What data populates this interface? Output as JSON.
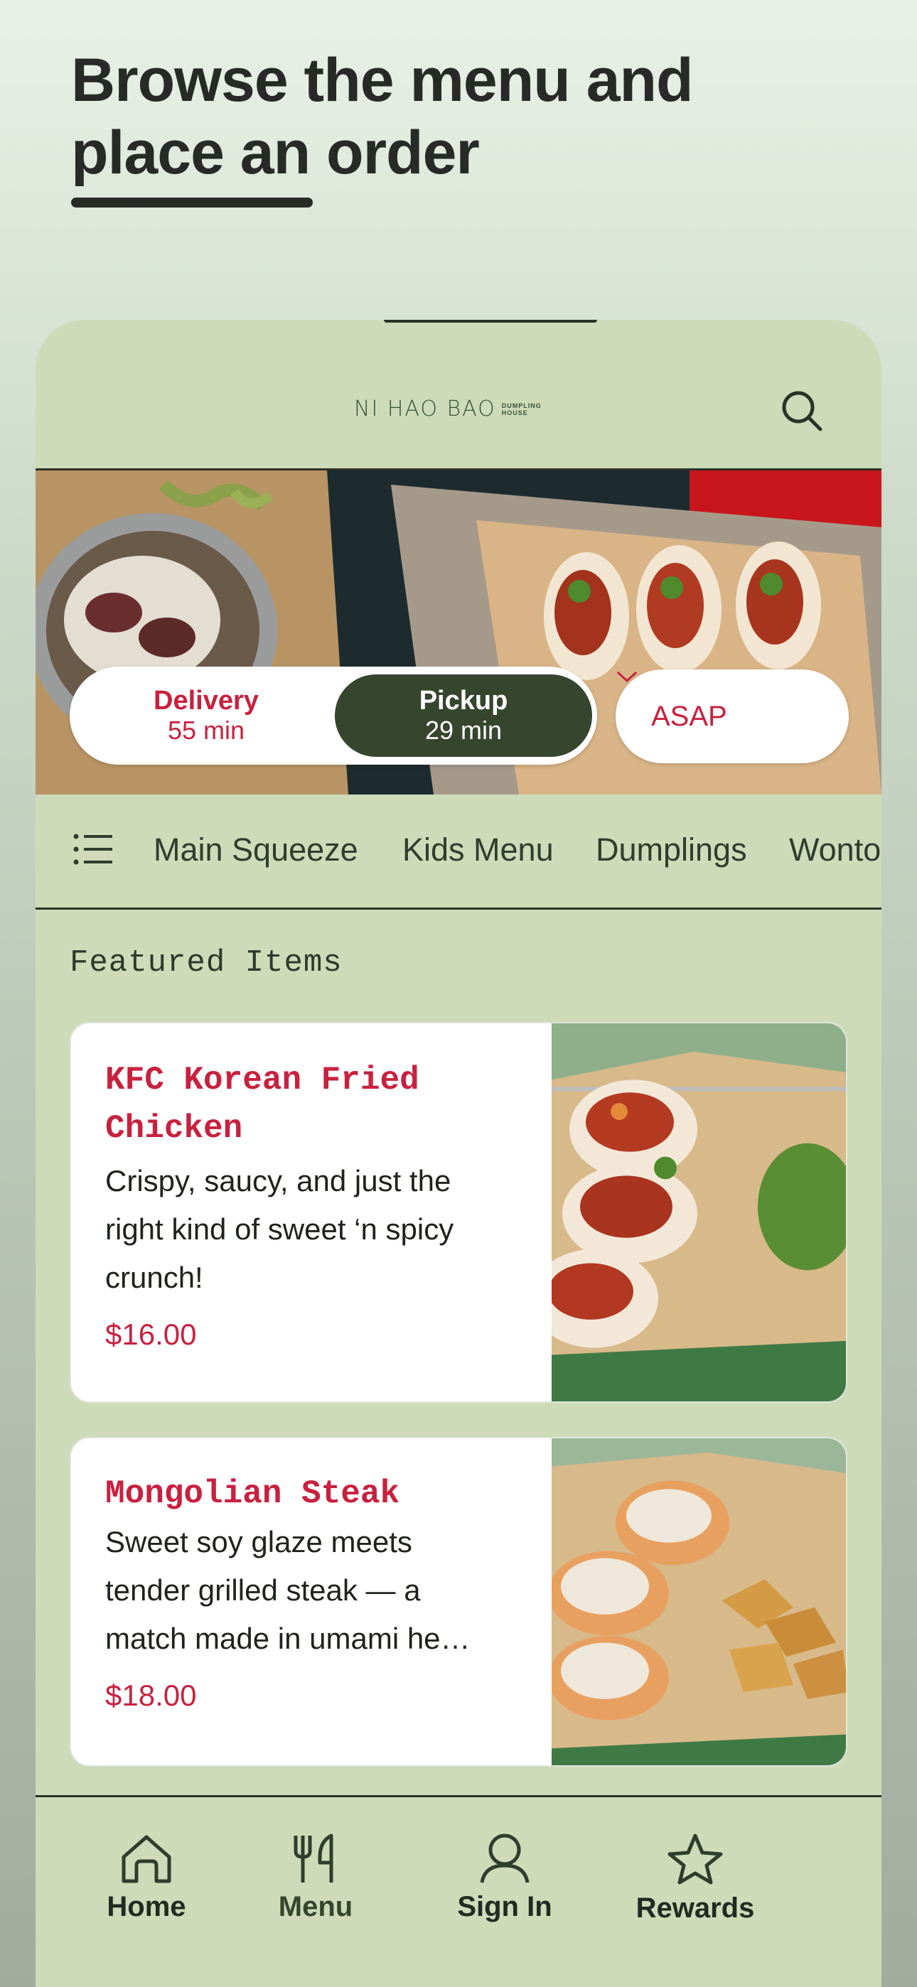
{
  "headline": {
    "line1": "Browse the menu and",
    "line2": "place an order"
  },
  "header": {
    "logo_main": "NI HAO BAO",
    "logo_sub_1": "DUMPLING",
    "logo_sub_2": "HOUSE",
    "search_icon": "search-icon"
  },
  "order_mode": {
    "delivery_label": "Delivery",
    "delivery_time": "55 min",
    "pickup_label": "Pickup",
    "pickup_time": "29 min",
    "selected": "Pickup",
    "time_select_value": "ASAP"
  },
  "categories": {
    "menu_icon": "list-icon",
    "items": [
      "Main Squeeze",
      "Kids Menu",
      "Dumplings",
      "Wonto"
    ]
  },
  "featured": {
    "title": "Featured Items",
    "items": [
      {
        "name_line1": "KFC Korean Fried",
        "name_line2": "Chicken",
        "desc_line1": "Crispy, saucy, and just the",
        "desc_line2": "right kind of sweet ‘n spicy",
        "desc_line3": "crunch!",
        "price": "$16.00"
      },
      {
        "name_line1": "Mongolian Steak",
        "desc_line1": "Sweet soy glaze meets",
        "desc_line2": "tender grilled steak — a",
        "desc_line3": "match made in umami he…",
        "price": "$18.00"
      }
    ]
  },
  "bottom_nav": {
    "items": [
      {
        "label": "Home",
        "icon": "home-icon"
      },
      {
        "label": "Menu",
        "icon": "fork-knife-icon"
      },
      {
        "label": "Sign In",
        "icon": "person-icon"
      },
      {
        "label": "Rewards",
        "icon": "star-icon"
      }
    ]
  },
  "colors": {
    "accent_red": "#c8213f",
    "dark_green": "#36452e",
    "app_background": "#cddbb8"
  }
}
